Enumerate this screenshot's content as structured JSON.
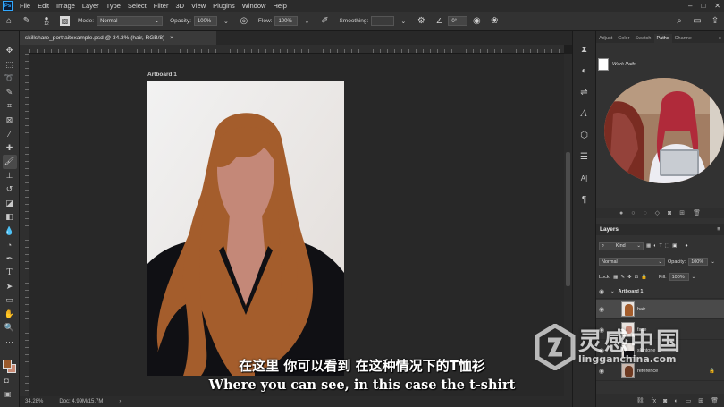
{
  "menu": {
    "logo": "Ps",
    "items": [
      "File",
      "Edit",
      "Image",
      "Layer",
      "Type",
      "Select",
      "Filter",
      "3D",
      "View",
      "Plugins",
      "Window",
      "Help"
    ]
  },
  "options": {
    "brush_size": "12",
    "mode_label": "Mode:",
    "mode_value": "Normal",
    "opacity_label": "Opacity:",
    "opacity_value": "100%",
    "flow_label": "Flow:",
    "flow_value": "100%",
    "smoothing_label": "Smoothing:",
    "angle_value": "0°"
  },
  "document": {
    "tab_title": "skillshare_portraitexample.psd @ 34.3% (hair, RGB/8)",
    "close": "×",
    "artboard_label": "Artboard 1"
  },
  "status": {
    "zoom": "34.28%",
    "doc": "Doc: 4.99M/15.7M"
  },
  "panels": {
    "tabs": [
      "Adjust",
      "Color",
      "Swatch",
      "Paths",
      "Channe"
    ],
    "active_tab": "Paths",
    "work_path": "Work Path"
  },
  "layers": {
    "title": "Layers",
    "kind": "Kind",
    "blend": "Normal",
    "opacity_label": "Opacity:",
    "opacity_value": "100%",
    "lock_label": "Lock:",
    "fill_label": "Fill:",
    "fill_value": "100%",
    "group": "Artboard 1",
    "items": [
      {
        "name": "hair"
      },
      {
        "name": "face"
      },
      {
        "name": "skintone"
      },
      {
        "name": "reference"
      }
    ]
  },
  "subtitles": {
    "cn": "在这里 你可以看到 在这种情况下的T恤衫",
    "en": "Where you can see, in this case the t-shirt"
  },
  "watermark": {
    "cn": "灵感中国",
    "en": "lingganchina.com"
  },
  "colors": {
    "foreground": "#9a5a2c",
    "background": "#c98a74",
    "hair": "#a45d2c",
    "skin": "#c48878",
    "shirt": "#101014"
  }
}
